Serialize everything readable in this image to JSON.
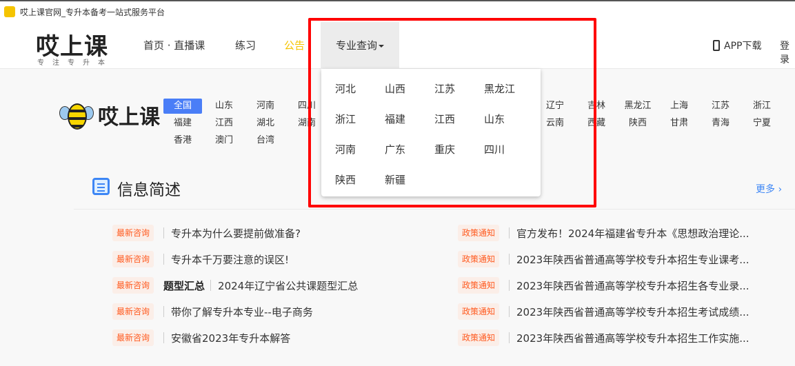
{
  "window": {
    "title": "哎上课官网_专升本备考一站式服务平台",
    "favicon_text": "哎上课"
  },
  "header": {
    "logo": "哎上课",
    "slogan": "专注专升本",
    "nav": [
      "首页 · 直播课",
      "练习",
      "公告",
      "专业查询"
    ],
    "app_download": "APP下载",
    "login": "登录"
  },
  "colors": {
    "accent": "#f5c400",
    "blue": "#4a7ef7",
    "tag": "#ff5a1f",
    "highlight": "#ff0000"
  },
  "provinces": {
    "brand": "哎上课",
    "left": [
      [
        "全国",
        "山东",
        "河南",
        "四川"
      ],
      [
        "福建",
        "江西",
        "湖北",
        "湖南"
      ],
      [
        "香港",
        "澳门",
        "台湾"
      ]
    ],
    "right": [
      [
        "辽宁",
        "吉林",
        "黑龙江",
        "上海",
        "江苏",
        "浙江"
      ],
      [
        "云南",
        "西藏",
        "陕西",
        "甘肃",
        "青海",
        "宁夏"
      ]
    ]
  },
  "dropdown": {
    "items": [
      "河北",
      "山西",
      "江苏",
      "黑龙江",
      "浙江",
      "福建",
      "江西",
      "山东",
      "河南",
      "广东",
      "重庆",
      "四川",
      "陕西",
      "新疆"
    ]
  },
  "section": {
    "title": "信息简述",
    "more": "更多"
  },
  "news_left": [
    {
      "tag": "最新咨询",
      "title": "专升本为什么要提前做准备?"
    },
    {
      "tag": "最新咨询",
      "title": "专升本千万要注意的误区!"
    },
    {
      "tag": "最新咨询",
      "label": "题型汇总",
      "title": "2024年辽宁省公共课题型汇总"
    },
    {
      "tag": "最新咨询",
      "title": "带你了解专升本专业--电子商务"
    },
    {
      "tag": "最新咨询",
      "title": "安徽省2023年专升本解答"
    }
  ],
  "news_right": [
    {
      "tag": "政策通知",
      "title": "官方发布！2024年福建省专升本《思想政治理论..."
    },
    {
      "tag": "政策通知",
      "title": "2023年陕西省普通高等学校专升本招生专业课考..."
    },
    {
      "tag": "政策通知",
      "title": "2023年陕西省普通高等学校专升本招生各专业录..."
    },
    {
      "tag": "政策通知",
      "title": "2023年陕西省普通高等学校专升本招生考试成绩..."
    },
    {
      "tag": "政策通知",
      "title": "2023年陕西省普通高等学校专升本招生工作实施..."
    }
  ]
}
